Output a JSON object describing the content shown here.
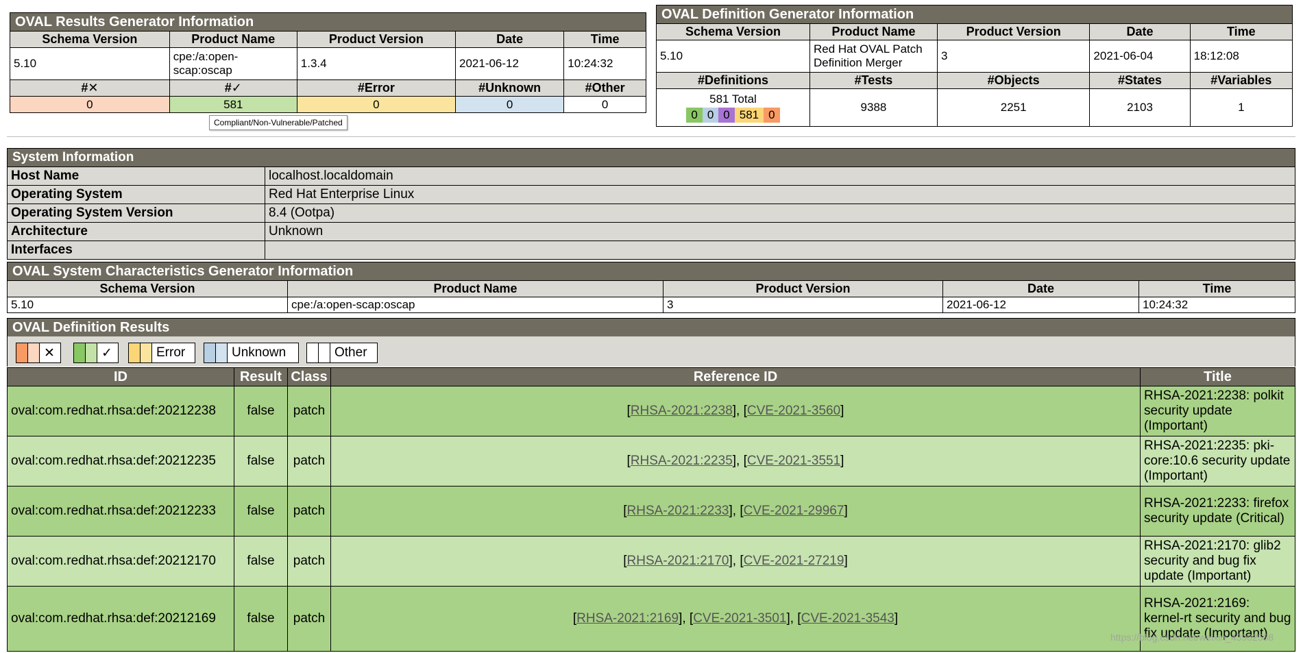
{
  "results_generator": {
    "title": "OVAL Results Generator Information",
    "headers": [
      "Schema Version",
      "Product Name",
      "Product Version",
      "Date",
      "Time"
    ],
    "values": [
      "5.10",
      "cpe:/a:open-scap:oscap",
      "1.3.4",
      "2021-06-12",
      "10:24:32"
    ],
    "count_headers": [
      "#✕",
      "#✓",
      "#Error",
      "#Unknown",
      "#Other"
    ],
    "counts": [
      "0",
      "581",
      "0",
      "0",
      "0"
    ]
  },
  "tooltip": "Compliant/Non-Vulnerable/Patched",
  "definition_generator": {
    "title": "OVAL Definition Generator Information",
    "headers": [
      "Schema Version",
      "Product Name",
      "Product Version",
      "Date",
      "Time"
    ],
    "values": [
      "5.10",
      "Red Hat OVAL Patch Definition Merger",
      "3",
      "2021-06-04",
      "18:12:08"
    ],
    "count_headers": [
      "#Definitions",
      "#Tests",
      "#Objects",
      "#States",
      "#Variables"
    ],
    "total": "581 Total",
    "mini_counts": [
      "0",
      "0",
      "0",
      "581",
      "0"
    ],
    "counts": [
      "9388",
      "2251",
      "2103",
      "1"
    ]
  },
  "system_information": {
    "title": "System Information",
    "rows": [
      {
        "label": "Host Name",
        "value": "localhost.localdomain"
      },
      {
        "label": "Operating System",
        "value": "Red Hat Enterprise Linux"
      },
      {
        "label": "Operating System Version",
        "value": "8.4 (Ootpa)"
      },
      {
        "label": "Architecture",
        "value": "Unknown"
      },
      {
        "label": "Interfaces",
        "value": ""
      }
    ]
  },
  "system_characteristics": {
    "title": "OVAL System Characteristics Generator Information",
    "headers": [
      "Schema Version",
      "Product Name",
      "Product Version",
      "Date",
      "Time"
    ],
    "values": [
      "5.10",
      "cpe:/a:open-scap:oscap",
      "3",
      "2021-06-12",
      "10:24:32"
    ]
  },
  "definition_results": {
    "title": "OVAL Definition Results",
    "legend": [
      {
        "label": "✕",
        "color": "#f79a64"
      },
      {
        "label": "✓",
        "color": "#89c765"
      },
      {
        "label": "Error",
        "color": "#fbd676"
      },
      {
        "label": "Unknown",
        "color": "#b9cfe3"
      },
      {
        "label": "Other",
        "color": "#ffffff"
      }
    ],
    "headers": [
      "ID",
      "Result",
      "Class",
      "Reference ID",
      "Title"
    ],
    "rows": [
      {
        "id": "oval:com.redhat.rhsa:def:20212238",
        "result": "false",
        "class": "patch",
        "refs": [
          "RHSA-2021:2238",
          "CVE-2021-3560"
        ],
        "title": "RHSA-2021:2238: polkit security update (Important)"
      },
      {
        "id": "oval:com.redhat.rhsa:def:20212235",
        "result": "false",
        "class": "patch",
        "refs": [
          "RHSA-2021:2235",
          "CVE-2021-3551"
        ],
        "title": "RHSA-2021:2235: pki-core:10.6 security update (Important)"
      },
      {
        "id": "oval:com.redhat.rhsa:def:20212233",
        "result": "false",
        "class": "patch",
        "refs": [
          "RHSA-2021:2233",
          "CVE-2021-29967"
        ],
        "title": "RHSA-2021:2233: firefox security update (Critical)"
      },
      {
        "id": "oval:com.redhat.rhsa:def:20212170",
        "result": "false",
        "class": "patch",
        "refs": [
          "RHSA-2021:2170",
          "CVE-2021-27219"
        ],
        "title": "RHSA-2021:2170: glib2 security and bug fix update (Important)"
      },
      {
        "id": "oval:com.redhat.rhsa:def:20212169",
        "result": "false",
        "class": "patch",
        "refs": [
          "RHSA-2021:2169",
          "CVE-2021-3501",
          "CVE-2021-3543"
        ],
        "title": "RHSA-2021:2169: kernel-rt security and bug fix update (Important)"
      }
    ]
  },
  "watermark": "https://blog.csdn.net/weixin_43902588"
}
